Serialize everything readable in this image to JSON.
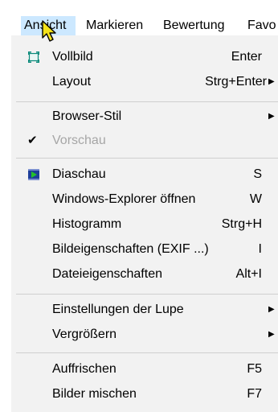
{
  "menubar": {
    "items": [
      "Ansicht",
      "Markieren",
      "Bewertung",
      "Favo"
    ]
  },
  "menu": {
    "items": [
      {
        "label": "Vollbild",
        "shortcut": "Enter",
        "icon": "fullscreen-icon"
      },
      {
        "label": "Layout",
        "shortcut": "Strg+Enter",
        "submenu": true
      },
      {
        "label": "Browser-Stil",
        "submenu": true
      },
      {
        "label": "Vorschau",
        "checked": true,
        "disabled": true
      },
      {
        "label": "Diaschau",
        "shortcut": "S",
        "icon": "slideshow-icon"
      },
      {
        "label": "Windows-Explorer öffnen",
        "shortcut": "W"
      },
      {
        "label": "Histogramm",
        "shortcut": "Strg+H"
      },
      {
        "label": "Bildeigenschaften (EXIF ...)",
        "shortcut": "I"
      },
      {
        "label": "Dateieigenschaften",
        "shortcut": "Alt+I"
      },
      {
        "label": "Einstellungen der Lupe",
        "submenu": true
      },
      {
        "label": "Vergrößern",
        "submenu": true
      },
      {
        "label": "Auffrischen",
        "shortcut": "F5"
      },
      {
        "label": "Bilder mischen",
        "shortcut": "F7"
      }
    ]
  },
  "glyphs": {
    "check": "✔",
    "submenu_arrow": "▶"
  },
  "colors": {
    "menubar_highlight": "#cce8ff",
    "menu_bg": "#f2f2f2",
    "disabled_text": "#a6a6a6"
  }
}
